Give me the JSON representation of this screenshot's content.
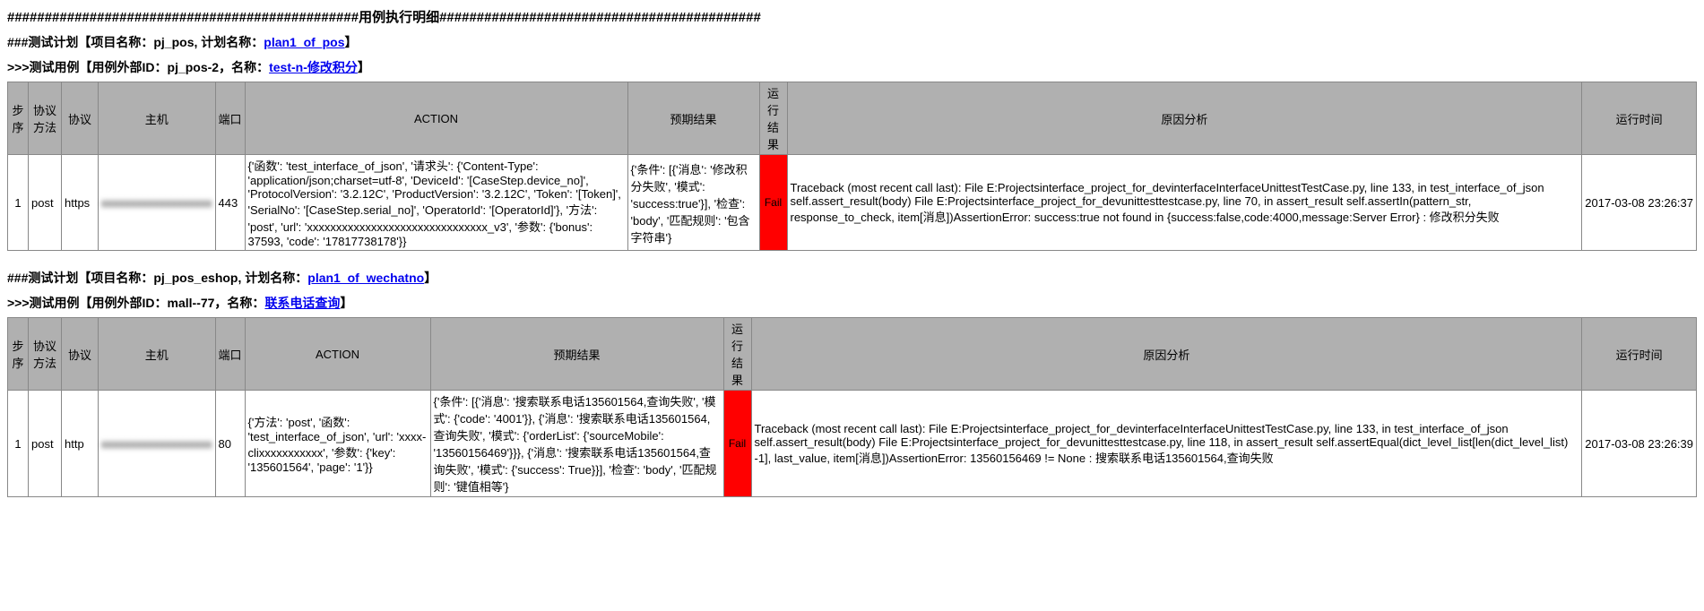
{
  "header": "###############################################用例执行明细###########################################",
  "plan1": {
    "prefix": "###测试计划【项目名称：pj_pos, 计划名称：",
    "link": "plan1_of_pos",
    "suffix": "】"
  },
  "case1": {
    "prefix": ">>>测试用例【用例外部ID：pj_pos-2，名称：",
    "link": "test-n-修改积分",
    "suffix": "】"
  },
  "columns": {
    "seq": "步序",
    "method": "协议方法",
    "proto": "协议",
    "host": "主机",
    "port": "端口",
    "action": "ACTION",
    "expect": "预期结果",
    "result": "运行结果",
    "reason": "原因分析",
    "time": "运行时间"
  },
  "row1": {
    "seq": "1",
    "method": "post",
    "proto": "https",
    "host": "xxxxxxxxxxxxxxxxxxx",
    "port": "443",
    "action": "{'函数': 'test_interface_of_json', '请求头': {'Content-Type': 'application/json;charset=utf-8', 'DeviceId': '[CaseStep.device_no]', 'ProtocolVersion': '3.2.12C', 'ProductVersion': '3.2.12C', 'Token': '[Token]', 'SerialNo': '[CaseStep.serial_no]', 'OperatorId': '[OperatorId]'}, '方法': 'post', 'url': 'xxxxxxxxxxxxxxxxxxxxxxxxxxxxxxx_v3', '参数': {'bonus': 37593, 'code': '17817738178'}}",
    "expect": "{'条件': [{'消息': '修改积分失败', '模式': 'success:true'}], '检查': 'body', '匹配规则': '包含字符串'}",
    "result": "Fail",
    "reason": "Traceback (most recent call last): File E:Projectsinterface_project_for_devinterfaceInterfaceUnittestTestCase.py, line 133, in test_interface_of_json self.assert_result(body) File E:Projectsinterface_project_for_devunittesttestcase.py, line 70, in assert_result self.assertIn(pattern_str, response_to_check, item[消息])AssertionError: success:true not found in {success:false,code:4000,message:Server Error} : 修改积分失败",
    "time": "2017-03-08 23:26:37"
  },
  "plan2": {
    "prefix": "###测试计划【项目名称：pj_pos_eshop, 计划名称：",
    "link": "plan1_of_wechatno",
    "suffix": "】"
  },
  "case2": {
    "prefix": ">>>测试用例【用例外部ID：mall--77，名称：",
    "link": "联系电话查询",
    "suffix": "】"
  },
  "row2": {
    "seq": "1",
    "method": "post",
    "proto": "http",
    "host": "xxxxxxxxxxxxxxxxxxx",
    "port": "80",
    "action": "{'方法': 'post', '函数': 'test_interface_of_json', 'url': 'xxxx-clixxxxxxxxxxx', '参数': {'key': '135601564', 'page': '1'}}",
    "expect": "{'条件': [{'消息': '搜索联系电话135601564,查询失败', '模式': {'code': '4001'}}, {'消息': '搜索联系电话135601564,查询失败', '模式': {'orderList': {'sourceMobile': '13560156469'}}}, {'消息': '搜索联系电话135601564,查询失败', '模式': {'success': True}}], '检查': 'body', '匹配规则': '键值相等'}",
    "result": "Fail",
    "reason": "Traceback (most recent call last): File E:Projectsinterface_project_for_devinterfaceInterfaceUnittestTestCase.py, line 133, in test_interface_of_json self.assert_result(body) File E:Projectsinterface_project_for_devunittesttestcase.py, line 118, in assert_result self.assertEqual(dict_level_list[len(dict_level_list) -1], last_value, item[消息])AssertionError: 13560156469 != None : 搜索联系电话135601564,查询失败",
    "time": "2017-03-08 23:26:39"
  }
}
